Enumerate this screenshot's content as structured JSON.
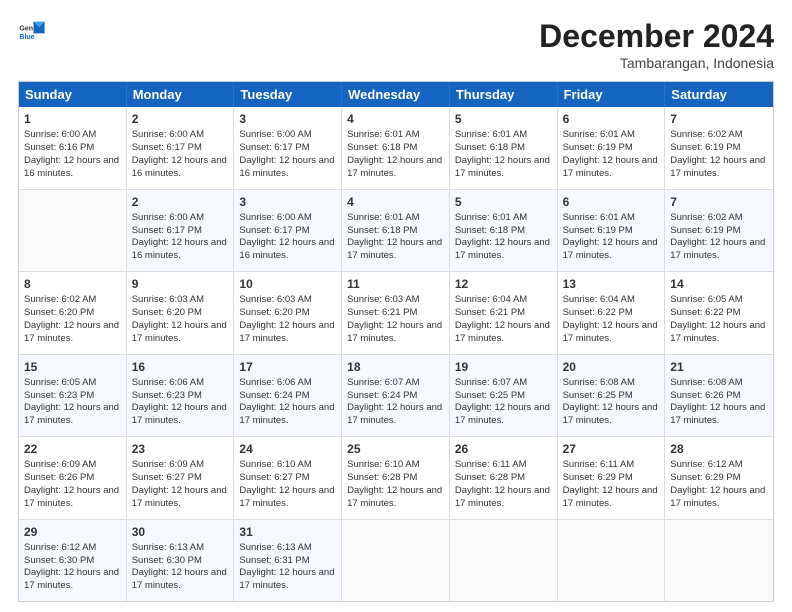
{
  "header": {
    "logo": {
      "general": "General",
      "blue": "Blue"
    },
    "month_year": "December 2024",
    "location": "Tambarangan, Indonesia"
  },
  "weekdays": [
    "Sunday",
    "Monday",
    "Tuesday",
    "Wednesday",
    "Thursday",
    "Friday",
    "Saturday"
  ],
  "rows": [
    [
      {
        "day": "",
        "sunrise": "",
        "sunset": "",
        "daylight": ""
      },
      {
        "day": "2",
        "sunrise": "Sunrise: 6:00 AM",
        "sunset": "Sunset: 6:17 PM",
        "daylight": "Daylight: 12 hours and 16 minutes."
      },
      {
        "day": "3",
        "sunrise": "Sunrise: 6:00 AM",
        "sunset": "Sunset: 6:17 PM",
        "daylight": "Daylight: 12 hours and 16 minutes."
      },
      {
        "day": "4",
        "sunrise": "Sunrise: 6:01 AM",
        "sunset": "Sunset: 6:18 PM",
        "daylight": "Daylight: 12 hours and 17 minutes."
      },
      {
        "day": "5",
        "sunrise": "Sunrise: 6:01 AM",
        "sunset": "Sunset: 6:18 PM",
        "daylight": "Daylight: 12 hours and 17 minutes."
      },
      {
        "day": "6",
        "sunrise": "Sunrise: 6:01 AM",
        "sunset": "Sunset: 6:19 PM",
        "daylight": "Daylight: 12 hours and 17 minutes."
      },
      {
        "day": "7",
        "sunrise": "Sunrise: 6:02 AM",
        "sunset": "Sunset: 6:19 PM",
        "daylight": "Daylight: 12 hours and 17 minutes."
      }
    ],
    [
      {
        "day": "8",
        "sunrise": "Sunrise: 6:02 AM",
        "sunset": "Sunset: 6:20 PM",
        "daylight": "Daylight: 12 hours and 17 minutes."
      },
      {
        "day": "9",
        "sunrise": "Sunrise: 6:03 AM",
        "sunset": "Sunset: 6:20 PM",
        "daylight": "Daylight: 12 hours and 17 minutes."
      },
      {
        "day": "10",
        "sunrise": "Sunrise: 6:03 AM",
        "sunset": "Sunset: 6:20 PM",
        "daylight": "Daylight: 12 hours and 17 minutes."
      },
      {
        "day": "11",
        "sunrise": "Sunrise: 6:03 AM",
        "sunset": "Sunset: 6:21 PM",
        "daylight": "Daylight: 12 hours and 17 minutes."
      },
      {
        "day": "12",
        "sunrise": "Sunrise: 6:04 AM",
        "sunset": "Sunset: 6:21 PM",
        "daylight": "Daylight: 12 hours and 17 minutes."
      },
      {
        "day": "13",
        "sunrise": "Sunrise: 6:04 AM",
        "sunset": "Sunset: 6:22 PM",
        "daylight": "Daylight: 12 hours and 17 minutes."
      },
      {
        "day": "14",
        "sunrise": "Sunrise: 6:05 AM",
        "sunset": "Sunset: 6:22 PM",
        "daylight": "Daylight: 12 hours and 17 minutes."
      }
    ],
    [
      {
        "day": "15",
        "sunrise": "Sunrise: 6:05 AM",
        "sunset": "Sunset: 6:23 PM",
        "daylight": "Daylight: 12 hours and 17 minutes."
      },
      {
        "day": "16",
        "sunrise": "Sunrise: 6:06 AM",
        "sunset": "Sunset: 6:23 PM",
        "daylight": "Daylight: 12 hours and 17 minutes."
      },
      {
        "day": "17",
        "sunrise": "Sunrise: 6:06 AM",
        "sunset": "Sunset: 6:24 PM",
        "daylight": "Daylight: 12 hours and 17 minutes."
      },
      {
        "day": "18",
        "sunrise": "Sunrise: 6:07 AM",
        "sunset": "Sunset: 6:24 PM",
        "daylight": "Daylight: 12 hours and 17 minutes."
      },
      {
        "day": "19",
        "sunrise": "Sunrise: 6:07 AM",
        "sunset": "Sunset: 6:25 PM",
        "daylight": "Daylight: 12 hours and 17 minutes."
      },
      {
        "day": "20",
        "sunrise": "Sunrise: 6:08 AM",
        "sunset": "Sunset: 6:25 PM",
        "daylight": "Daylight: 12 hours and 17 minutes."
      },
      {
        "day": "21",
        "sunrise": "Sunrise: 6:08 AM",
        "sunset": "Sunset: 6:26 PM",
        "daylight": "Daylight: 12 hours and 17 minutes."
      }
    ],
    [
      {
        "day": "22",
        "sunrise": "Sunrise: 6:09 AM",
        "sunset": "Sunset: 6:26 PM",
        "daylight": "Daylight: 12 hours and 17 minutes."
      },
      {
        "day": "23",
        "sunrise": "Sunrise: 6:09 AM",
        "sunset": "Sunset: 6:27 PM",
        "daylight": "Daylight: 12 hours and 17 minutes."
      },
      {
        "day": "24",
        "sunrise": "Sunrise: 6:10 AM",
        "sunset": "Sunset: 6:27 PM",
        "daylight": "Daylight: 12 hours and 17 minutes."
      },
      {
        "day": "25",
        "sunrise": "Sunrise: 6:10 AM",
        "sunset": "Sunset: 6:28 PM",
        "daylight": "Daylight: 12 hours and 17 minutes."
      },
      {
        "day": "26",
        "sunrise": "Sunrise: 6:11 AM",
        "sunset": "Sunset: 6:28 PM",
        "daylight": "Daylight: 12 hours and 17 minutes."
      },
      {
        "day": "27",
        "sunrise": "Sunrise: 6:11 AM",
        "sunset": "Sunset: 6:29 PM",
        "daylight": "Daylight: 12 hours and 17 minutes."
      },
      {
        "day": "28",
        "sunrise": "Sunrise: 6:12 AM",
        "sunset": "Sunset: 6:29 PM",
        "daylight": "Daylight: 12 hours and 17 minutes."
      }
    ],
    [
      {
        "day": "29",
        "sunrise": "Sunrise: 6:12 AM",
        "sunset": "Sunset: 6:30 PM",
        "daylight": "Daylight: 12 hours and 17 minutes."
      },
      {
        "day": "30",
        "sunrise": "Sunrise: 6:13 AM",
        "sunset": "Sunset: 6:30 PM",
        "daylight": "Daylight: 12 hours and 17 minutes."
      },
      {
        "day": "31",
        "sunrise": "Sunrise: 6:13 AM",
        "sunset": "Sunset: 6:31 PM",
        "daylight": "Daylight: 12 hours and 17 minutes."
      },
      {
        "day": "",
        "sunrise": "",
        "sunset": "",
        "daylight": ""
      },
      {
        "day": "",
        "sunrise": "",
        "sunset": "",
        "daylight": ""
      },
      {
        "day": "",
        "sunrise": "",
        "sunset": "",
        "daylight": ""
      },
      {
        "day": "",
        "sunrise": "",
        "sunset": "",
        "daylight": ""
      }
    ]
  ],
  "row0_day1": {
    "day": "1",
    "sunrise": "Sunrise: 6:00 AM",
    "sunset": "Sunset: 6:16 PM",
    "daylight": "Daylight: 12 hours and 16 minutes."
  }
}
